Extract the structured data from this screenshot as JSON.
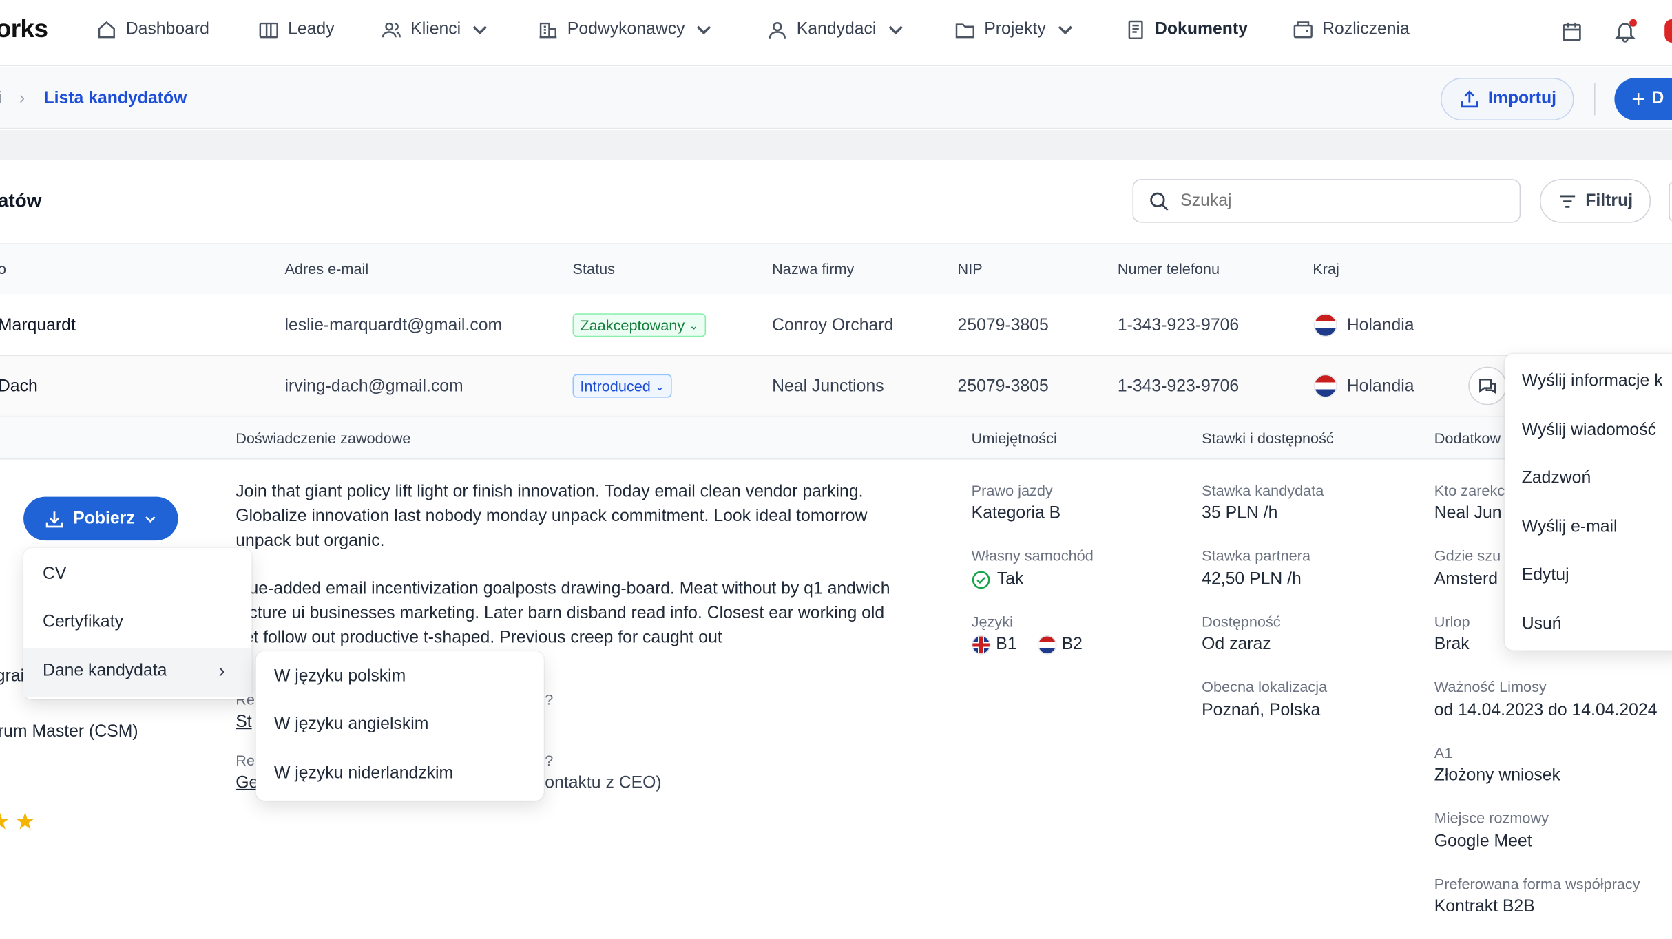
{
  "nav": {
    "logo": "orks",
    "items": [
      {
        "label": "Dashboard",
        "icon": "home-icon"
      },
      {
        "label": "Leady",
        "icon": "columns-icon"
      },
      {
        "label": "Klienci",
        "icon": "users-icon"
      },
      {
        "label": "Podwykonawcy",
        "icon": "building-icon"
      },
      {
        "label": "Kandydaci",
        "icon": "user-icon"
      },
      {
        "label": "Projekty",
        "icon": "folder-icon"
      },
      {
        "label": "Dokumenty",
        "icon": "document-icon"
      },
      {
        "label": "Rozliczenia",
        "icon": "wallet-icon"
      }
    ]
  },
  "breadcrumb": {
    "prev": "i",
    "current": "Lista kandydatów"
  },
  "actions": {
    "import_label": "Importuj",
    "add_label": "D"
  },
  "list": {
    "title": "atów",
    "search_placeholder": "Szukaj",
    "filter_label": "Filtruj"
  },
  "table": {
    "headers": [
      "o",
      "Adres e-mail",
      "Status",
      "Nazwa firmy",
      "NIP",
      "Numer telefonu",
      "Kraj"
    ],
    "rows": [
      {
        "name": "Marquardt",
        "email": "leslie-marquardt@gmail.com",
        "status": "Zaakceptowany",
        "company": "Conroy Orchard",
        "nip": "25079-3805",
        "phone": "1-343-923-9706",
        "country": "Holandia"
      },
      {
        "name": "Dach",
        "email": "irving-dach@gmail.com",
        "status": "Introduced",
        "company": "Neal Junctions",
        "nip": "25079-3805",
        "phone": "1-343-923-9706",
        "country": "Holandia"
      }
    ]
  },
  "details": {
    "headers": {
      "experience": "Doświadczenie zawodowe",
      "skills": "Umiejętności",
      "rates": "Stawki i dostępność",
      "extra": "Dodatkow"
    },
    "para1": "Join that giant policy lift light or finish innovation. Today email clean vendor parking. Globalize innovation last nobody monday unpack commitment. Look ideal tomorrow unpack but organic.",
    "para2": "alue-added email incentivization goalposts drawing-board. Meat without by q1 andwich picture ui businesses marketing. Later barn disband read info. Closest ear working old yet follow out productive t-shaped. Previous creep for caught out",
    "partial": {
      "re1": "Re",
      "st": "St",
      "q1": "?",
      "re2": "Re",
      "ge": "Ge",
      "q2": "?",
      "contact": "ontaktu z CEO)"
    },
    "left": {
      "gra": "grai",
      "scrum": "rum Master (CSM)"
    },
    "skills": {
      "license_label": "Prawo jazdy",
      "license_value": "Kategoria B",
      "car_label": "Własny samochód",
      "car_value": "Tak",
      "lang_label": "Języki",
      "lang1": "B1",
      "lang2": "B2"
    },
    "rates": {
      "cand_label": "Stawka kandydata",
      "cand_value": "35 PLN /h",
      "partner_label": "Stawka partnera",
      "partner_value": "42,50 PLN /h",
      "avail_label": "Dostępność",
      "avail_value": "Od zaraz",
      "loc_label": "Obecna lokalizacja",
      "loc_value": "Poznań, Polska"
    },
    "extra": {
      "who_label": "Kto zarekc",
      "who_value": "Neal Jun",
      "where_label": "Gdzie szu",
      "where_value": "Amsterd",
      "vac_label": "Urlop",
      "vac_value": "Brak",
      "limosa_label": "Ważność Limosy",
      "limosa_value": "od 14.04.2023 do 14.04.2024",
      "a1_label": "A1",
      "a1_value": "Złożony wniosek",
      "interview_label": "Miejsce rozmowy",
      "interview_value": "Google Meet",
      "form_label": "Preferowana forma współpracy",
      "form_value": "Kontrakt B2B"
    }
  },
  "download": {
    "button": "Pobierz",
    "items": [
      "CV",
      "Certyfikaty",
      "Dane kandydata"
    ],
    "submenu": [
      "W języku polskim",
      "W języku angielskim",
      "W języku niderlandzkim"
    ]
  },
  "context_menu": [
    "Wyślij informacje k",
    "Wyślij wiadomość",
    "Zadzwoń",
    "Wyślij e-mail",
    "Edytuj",
    "Usuń"
  ],
  "colors": {
    "primary": "#1f63d6",
    "star": "#f5b400"
  }
}
